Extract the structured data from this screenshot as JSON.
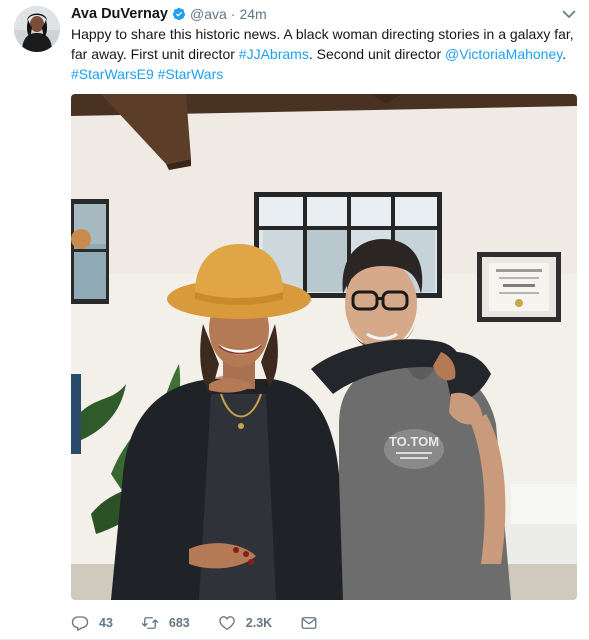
{
  "tweet": {
    "author_name": "Ava DuVernay",
    "handle": "@ava",
    "separator": "·",
    "time": "24m",
    "text_parts": [
      {
        "text": "Happy to share this historic news. A black woman directing stories in a galaxy far, far away. First unit director ",
        "type": "text"
      },
      {
        "text": "#JJAbrams",
        "type": "link"
      },
      {
        "text": ". Second unit director ",
        "type": "text"
      },
      {
        "text": "@VictoriaMahoney",
        "type": "link"
      },
      {
        "text": ". ",
        "type": "text"
      },
      {
        "text": "#StarWarsE9",
        "type": "link"
      },
      {
        "text": " ",
        "type": "text"
      },
      {
        "text": "#StarWars",
        "type": "link"
      }
    ],
    "photo": {
      "shirt_text": "TO.TOM"
    },
    "actions": {
      "replies": "43",
      "retweets": "683",
      "likes": "2.3K"
    }
  },
  "colors": {
    "link": "#1da1f2",
    "muted": "#657786",
    "verified": "#1da1f2"
  }
}
